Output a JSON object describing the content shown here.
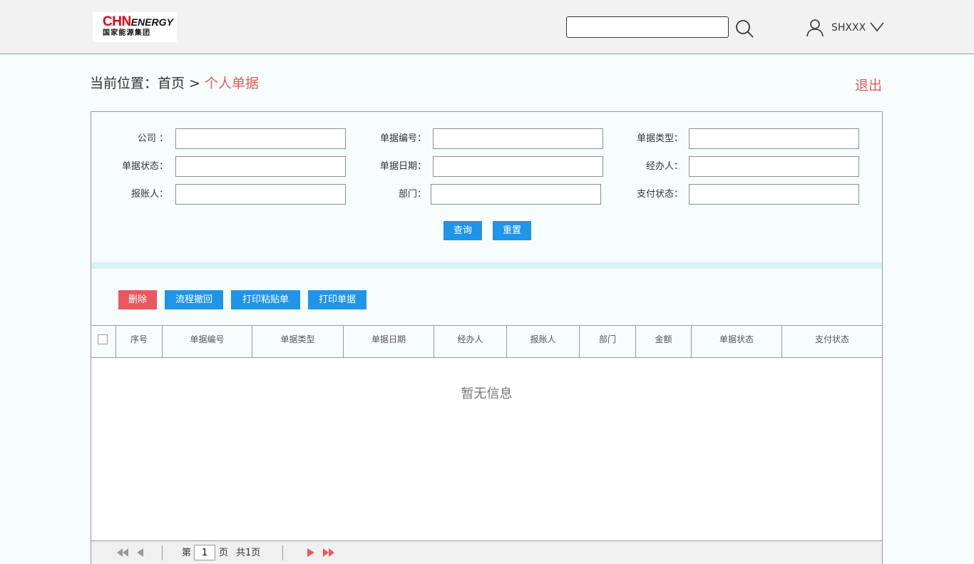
{
  "header": {
    "logo": {
      "brand_red": "CHN",
      "brand_black": "ENERGY",
      "subtitle": "国家能源集团"
    },
    "search": {
      "value": "",
      "placeholder": ""
    },
    "user": {
      "name": "SHXXX"
    }
  },
  "breadcrumb": {
    "prefix": "当前位置：首页 > ",
    "current": "个人单据"
  },
  "logout_label": "退出",
  "filters": {
    "company_label": "公司 ：",
    "doc_no_label": "单据编号：",
    "doc_type_label": "单据类型：",
    "doc_status_label": "单据状态：",
    "doc_date_label": "单据日期：",
    "handler_label": "经办人：",
    "claimant_label": "报账人：",
    "dept_label": "部门：",
    "pay_status_label": "支付状态：",
    "values": {
      "company": "",
      "doc_no": "",
      "doc_type": "",
      "doc_status": "",
      "doc_date": "",
      "handler": "",
      "claimant": "",
      "dept": "",
      "pay_status": ""
    },
    "query_label": "查询",
    "reset_label": "重置"
  },
  "toolbar": {
    "delete": "删除",
    "revoke": "流程撤回",
    "print_sticker": "打印粘贴单",
    "print_doc": "打印单据"
  },
  "table": {
    "columns": [
      "序号",
      "单据编号",
      "单据类型",
      "单据日期",
      "经办人",
      "报账人",
      "部门",
      "金额",
      "单据状态",
      "支付状态"
    ],
    "empty_text": "暂无信息"
  },
  "pager": {
    "prefix": "第",
    "page": "1",
    "suffix": "页",
    "total": "共1页"
  },
  "colors": {
    "accent_blue": "#1e95e8",
    "danger_red": "#e9585f",
    "link_red": "#e05c5c",
    "brand_red": "#e60012"
  }
}
